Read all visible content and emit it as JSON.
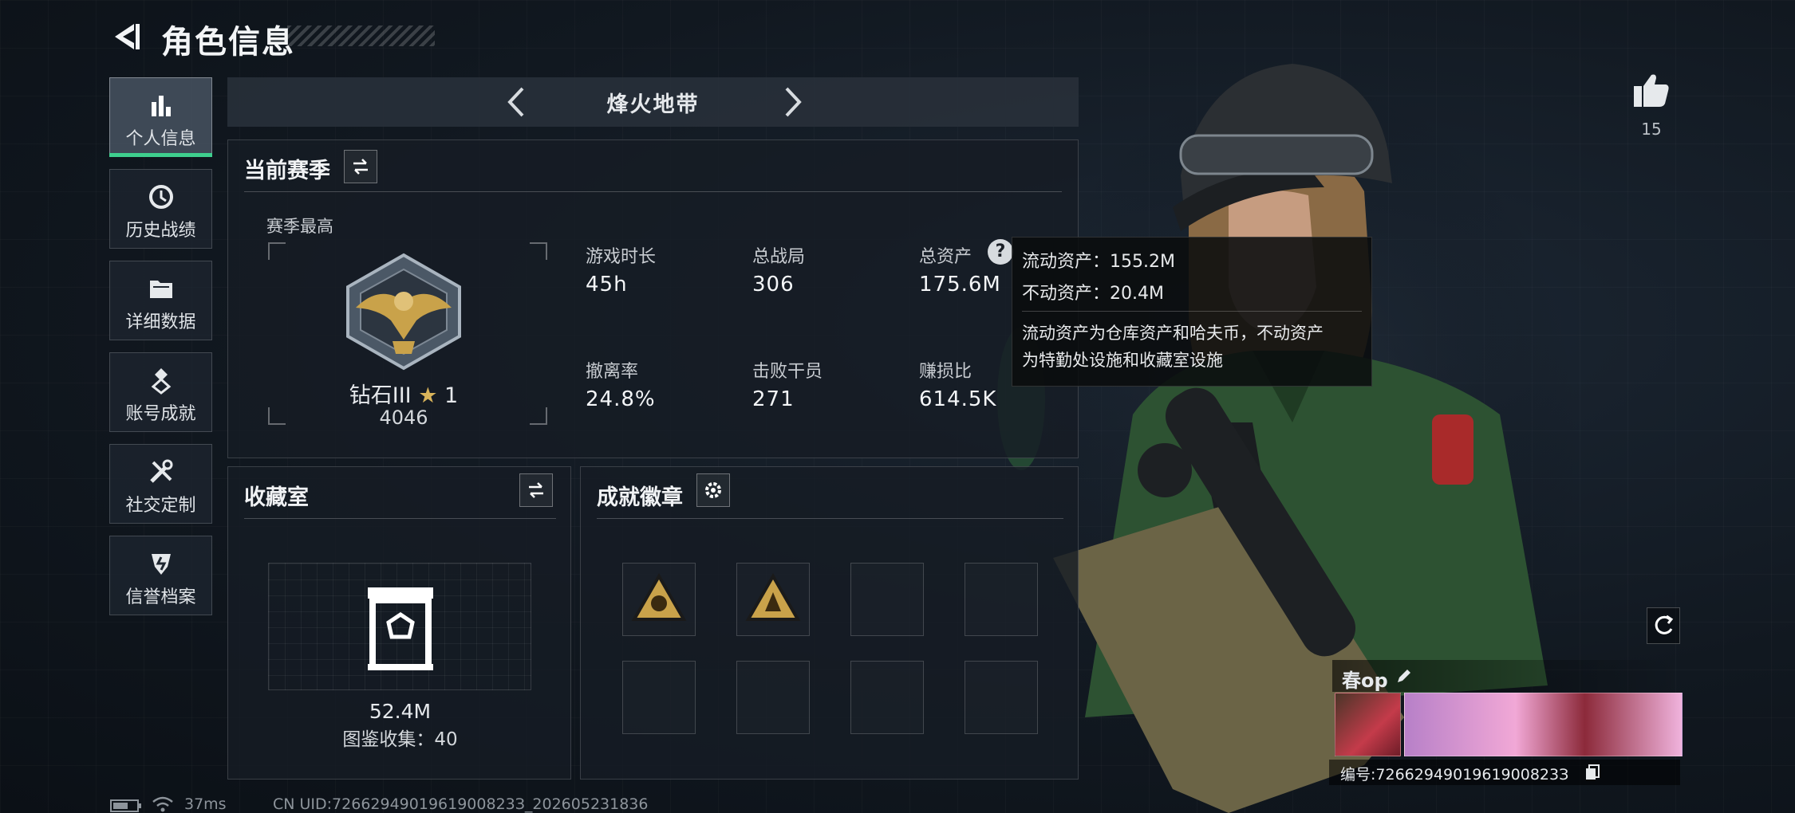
{
  "header": {
    "title": "角色信息"
  },
  "sidebar": {
    "items": [
      {
        "label": "个人信息",
        "active": true
      },
      {
        "label": "历史战绩"
      },
      {
        "label": "详细数据"
      },
      {
        "label": "账号成就"
      },
      {
        "label": "社交定制"
      },
      {
        "label": "信誉档案"
      }
    ]
  },
  "mode": {
    "label": "烽火地带"
  },
  "season": {
    "title": "当前赛季",
    "best_label": "赛季最高",
    "rank_name": "钻石III",
    "rank_stars": "1",
    "rank_score": "4046",
    "stats": [
      {
        "label": "游戏时长",
        "value": "45h"
      },
      {
        "label": "总战局",
        "value": "306"
      },
      {
        "label": "总资产",
        "value": "175.6M"
      },
      {
        "label": "撤离率",
        "value": "24.8%"
      },
      {
        "label": "击败干员",
        "value": "271"
      },
      {
        "label": "赚损比",
        "value": "614.5K"
      }
    ]
  },
  "tooltip": {
    "line1": "流动资产：155.2M",
    "line2": "不动资产：20.4M",
    "desc1": "流动资产为仓库资产和哈夫币，不动资产",
    "desc2": "为特勤处设施和收藏室设施"
  },
  "collection": {
    "title": "收藏室",
    "value": "52.4M",
    "count_text": "图鉴收集：40"
  },
  "achievements": {
    "title": "成就徽章",
    "filled_slots": 2,
    "total_slots": 8
  },
  "likes": {
    "count": "15"
  },
  "player": {
    "name": "春op",
    "id_text": "编号:7266294901961900823З"
  },
  "status_bar": {
    "ping": "37ms",
    "uid_text": "CN UID:7266294901961900823З_202605231836"
  },
  "colors": {
    "accent": "#3ecf8e",
    "gold": "#c9a24a"
  }
}
